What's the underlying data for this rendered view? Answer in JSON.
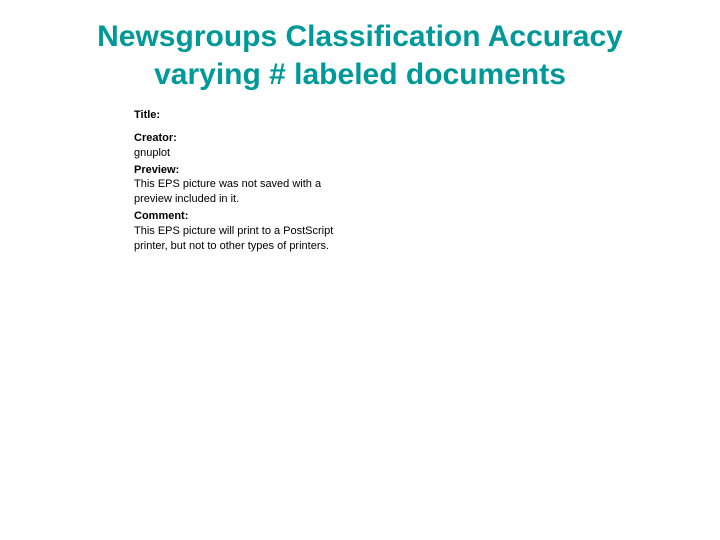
{
  "title_line1": "Newsgroups Classification Accuracy",
  "title_line2": "varying # labeled documents",
  "eps": {
    "title_label": "Title:",
    "creator_label": "Creator:",
    "creator_value": "gnuplot",
    "preview_label": "Preview:",
    "preview_value": "This EPS picture was not saved with a preview included in it.",
    "comment_label": "Comment:",
    "comment_value": "This EPS picture will print to a PostScript printer, but not to other types of printers."
  }
}
